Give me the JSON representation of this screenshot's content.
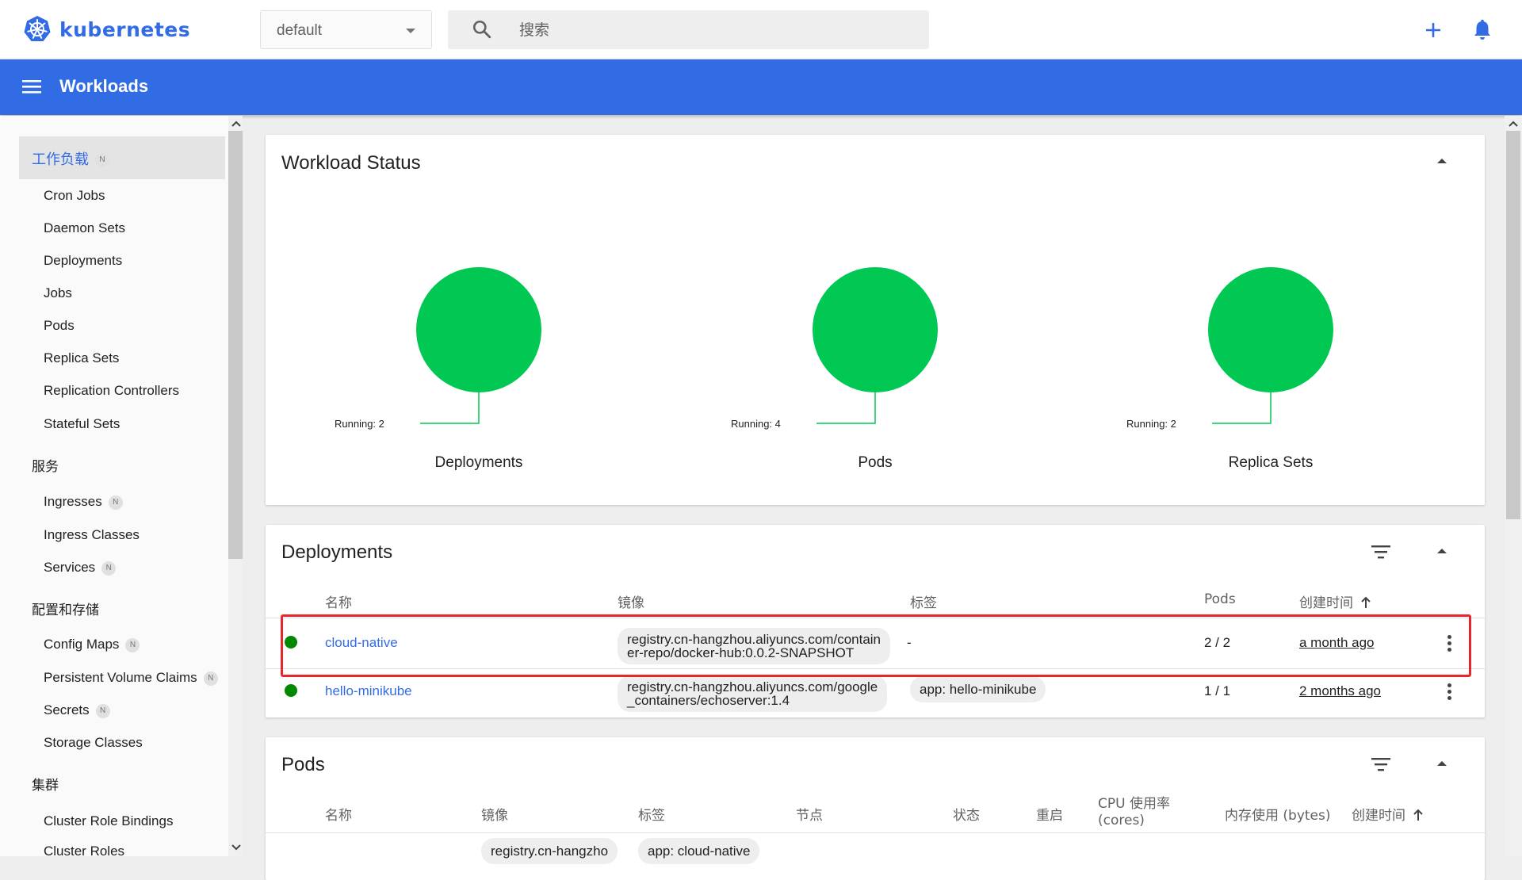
{
  "app": {
    "name": "kubernetes"
  },
  "header": {
    "namespace": "default",
    "search_placeholder": "搜索",
    "page_title": "Workloads"
  },
  "sidebar": {
    "active_section": "工作负载",
    "workloads": [
      "Cron Jobs",
      "Daemon Sets",
      "Deployments",
      "Jobs",
      "Pods",
      "Replica Sets",
      "Replication Controllers",
      "Stateful Sets"
    ],
    "services_header": "服务",
    "services": [
      "Ingresses",
      "Ingress Classes",
      "Services"
    ],
    "config_header": "配置和存储",
    "config": [
      "Config Maps",
      "Persistent Volume Claims",
      "Secrets",
      "Storage Classes"
    ],
    "cluster_header": "集群",
    "cluster": [
      "Cluster Role Bindings",
      "Cluster Roles"
    ],
    "badge": "N"
  },
  "workload_status": {
    "title": "Workload Status",
    "items": [
      {
        "running": "Running: 2",
        "name": "Deployments",
        "color": "#00c853"
      },
      {
        "running": "Running: 4",
        "name": "Pods",
        "color": "#00c853"
      },
      {
        "running": "Running: 2",
        "name": "Replica Sets",
        "color": "#00c853"
      }
    ]
  },
  "deployments": {
    "title": "Deployments",
    "columns": {
      "name": "名称",
      "image": "镜像",
      "labels": "标签",
      "pods": "Pods",
      "created": "创建时间"
    },
    "rows": [
      {
        "name": "cloud-native",
        "image_line1": "registry.cn-hangzhou.aliyuncs.com/contain",
        "image_line2": "er-repo/docker-hub:0.0.2-SNAPSHOT",
        "labels": "-",
        "pods": "2 / 2",
        "created": "a month ago"
      },
      {
        "name": "hello-minikube",
        "image_line1": "registry.cn-hangzhou.aliyuncs.com/google",
        "image_line2": "_containers/echoserver:1.4",
        "labels": "app: hello-minikube",
        "pods": "1 / 1",
        "created": "2 months ago"
      }
    ]
  },
  "pods": {
    "title": "Pods",
    "columns": {
      "name": "名称",
      "image": "镜像",
      "labels": "标签",
      "node": "节点",
      "status": "状态",
      "restarts": "重启",
      "cpu_line1": "CPU 使用率",
      "cpu_line2": "(cores)",
      "memory": "内存使用 (bytes)",
      "created": "创建时间"
    },
    "first_row": {
      "image": "registry.cn-hangzho",
      "labels": "app: cloud-native"
    }
  },
  "colors": {
    "brand": "#326ce5",
    "running": "#00c853",
    "status_dot": "#008a00",
    "highlight": "#e8262b"
  }
}
